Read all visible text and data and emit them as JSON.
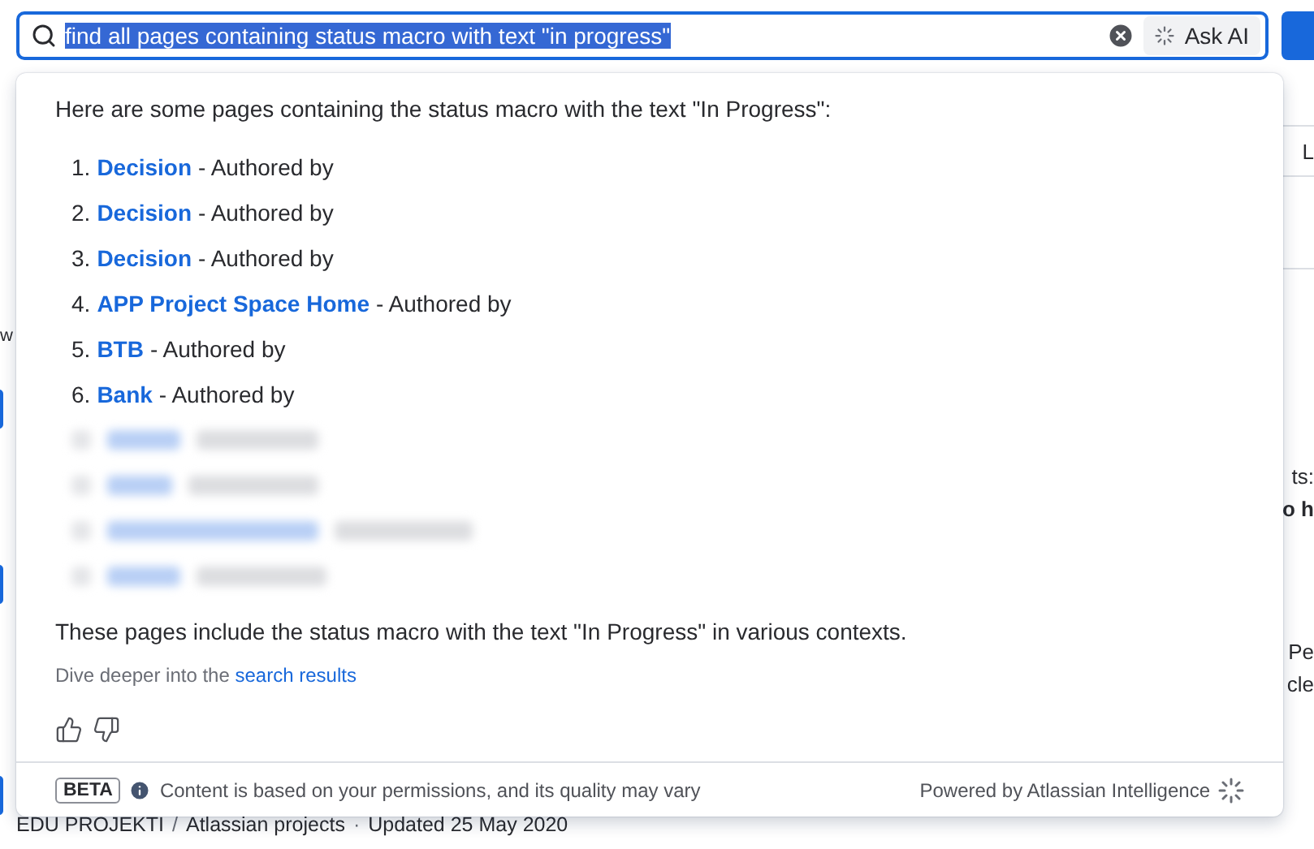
{
  "search": {
    "query": "find all pages containing status macro with text \"in progress\"",
    "query_selected": true,
    "ask_ai": "Ask AI"
  },
  "answer": {
    "intro": "Here are some pages containing the status macro with the text \"In Progress\":",
    "results": [
      {
        "kind": "link",
        "number": "1.",
        "title": "Decision",
        "suffix": "- Authored by"
      },
      {
        "kind": "link",
        "number": "2.",
        "title": "Decision",
        "suffix": "- Authored by"
      },
      {
        "kind": "link",
        "number": "3.",
        "title": "Decision",
        "suffix": "- Authored by"
      },
      {
        "kind": "link",
        "number": "4.",
        "title": "APP Project Space Home",
        "suffix": "- Authored by"
      },
      {
        "kind": "link",
        "number": "5.",
        "title": "BTB",
        "suffix": "- Authored by"
      },
      {
        "kind": "link",
        "number": "6.",
        "title": "Bank",
        "suffix": "- Authored by"
      },
      {
        "kind": "blurred"
      },
      {
        "kind": "blurred"
      },
      {
        "kind": "blurred"
      },
      {
        "kind": "blurred"
      }
    ],
    "summary": "These pages include the status macro with the text \"In Progress\" in various contexts.",
    "dive_prefix": "Dive deeper into the",
    "dive_link": "search results"
  },
  "footer": {
    "badge": "BETA",
    "notice": "Content is based on your permissions, and its quality may vary",
    "powered_by": "Powered by Atlassian Intelligence"
  },
  "background": {
    "left_fragment": "w",
    "right_fragments": [
      "L",
      "ts:",
      "o h",
      "Pe",
      "cle"
    ],
    "breadcrumb": [
      "EDU PROJEKTI",
      "Atlassian projects"
    ],
    "separators": [
      "/",
      "·"
    ],
    "updated": "Updated 25 May 2020"
  }
}
